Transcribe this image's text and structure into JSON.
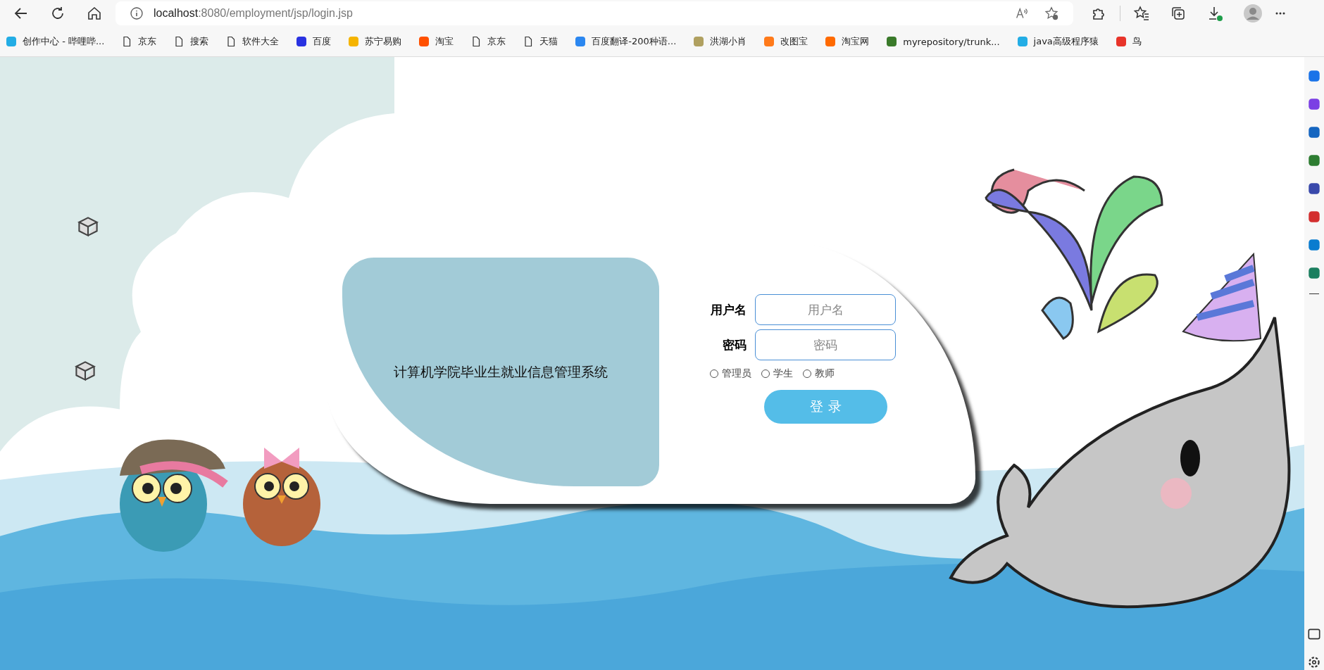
{
  "browser": {
    "url_host": "localhost",
    "url_path": ":8080/employment/jsp/login.jsp"
  },
  "bookmarks": [
    {
      "label": "创作中心 - 哔哩哔...",
      "kind": "site",
      "color": "#23ade5"
    },
    {
      "label": "京东",
      "kind": "page"
    },
    {
      "label": "搜索",
      "kind": "page"
    },
    {
      "label": "软件大全",
      "kind": "page"
    },
    {
      "label": "百度",
      "kind": "site",
      "color": "#2932e1"
    },
    {
      "label": "苏宁易购",
      "kind": "site",
      "color": "#f5b400"
    },
    {
      "label": "淘宝",
      "kind": "site",
      "color": "#ff5000"
    },
    {
      "label": "京东",
      "kind": "page"
    },
    {
      "label": "天猫",
      "kind": "page"
    },
    {
      "label": "百度翻译-200种语...",
      "kind": "site",
      "color": "#2b87f0"
    },
    {
      "label": "洪湖小肖",
      "kind": "site",
      "color": "#b0a060"
    },
    {
      "label": "改图宝",
      "kind": "site",
      "color": "#ff7a1a"
    },
    {
      "label": "淘宝网",
      "kind": "site",
      "color": "#ff6a00"
    },
    {
      "label": "myrepository/trunk...",
      "kind": "site",
      "color": "#3a7a2a"
    },
    {
      "label": "java高级程序猿",
      "kind": "site",
      "color": "#23ade5"
    },
    {
      "label": "鸟",
      "kind": "site",
      "color": "#e8342a"
    }
  ],
  "login": {
    "title": "计算机学院毕业生就业信息管理系统",
    "fields": [
      {
        "label": "用户名",
        "placeholder": "用户名"
      },
      {
        "label": "密码",
        "placeholder": "密码"
      }
    ],
    "roles": [
      {
        "label": "管理员",
        "selected": false
      },
      {
        "label": "学生",
        "selected": false
      },
      {
        "label": "教师",
        "selected": false
      }
    ],
    "submit": "登 录"
  }
}
